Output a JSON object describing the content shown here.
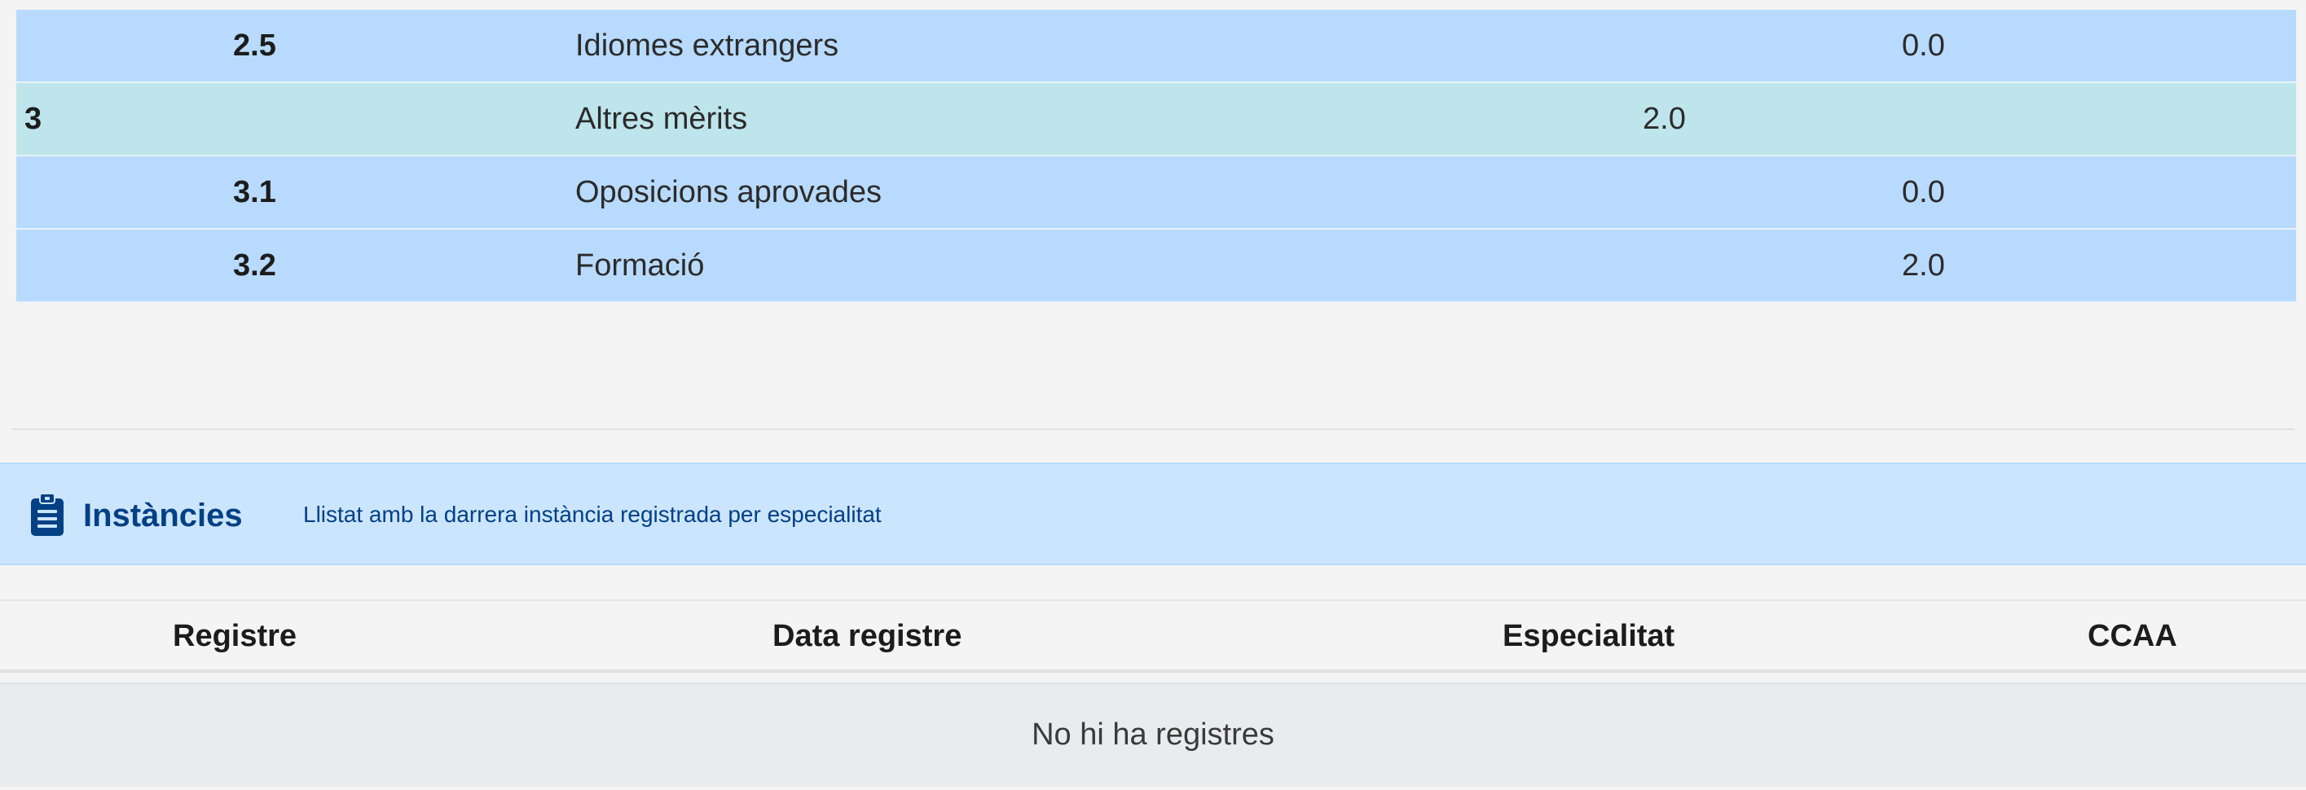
{
  "merits": {
    "rows": [
      {
        "code": "2.5",
        "description": "Idiomes extrangers",
        "group_value": "",
        "sub_value": "0.0"
      },
      {
        "code": "3",
        "description": "Altres mèrits",
        "group_value": "2.0",
        "sub_value": ""
      },
      {
        "code": "3.1",
        "description": "Oposicions aprovades",
        "group_value": "",
        "sub_value": "0.0"
      },
      {
        "code": "3.2",
        "description": "Formació",
        "group_value": "",
        "sub_value": "2.0"
      }
    ]
  },
  "instancies": {
    "icon": "clipboard-icon",
    "title": "Instàncies",
    "subtitle": "Llistat amb la darrera instància registrada per especialitat",
    "columns": [
      "Registre",
      "Data registre",
      "Especialitat",
      "CCAA"
    ],
    "empty_message": "No hi ha registres"
  },
  "colors": {
    "subrow": "#b8daff",
    "group_row": "#bee5eb",
    "card_header": "#cce5ff",
    "card_text": "#004085",
    "empty_row": "#e9ecef"
  }
}
